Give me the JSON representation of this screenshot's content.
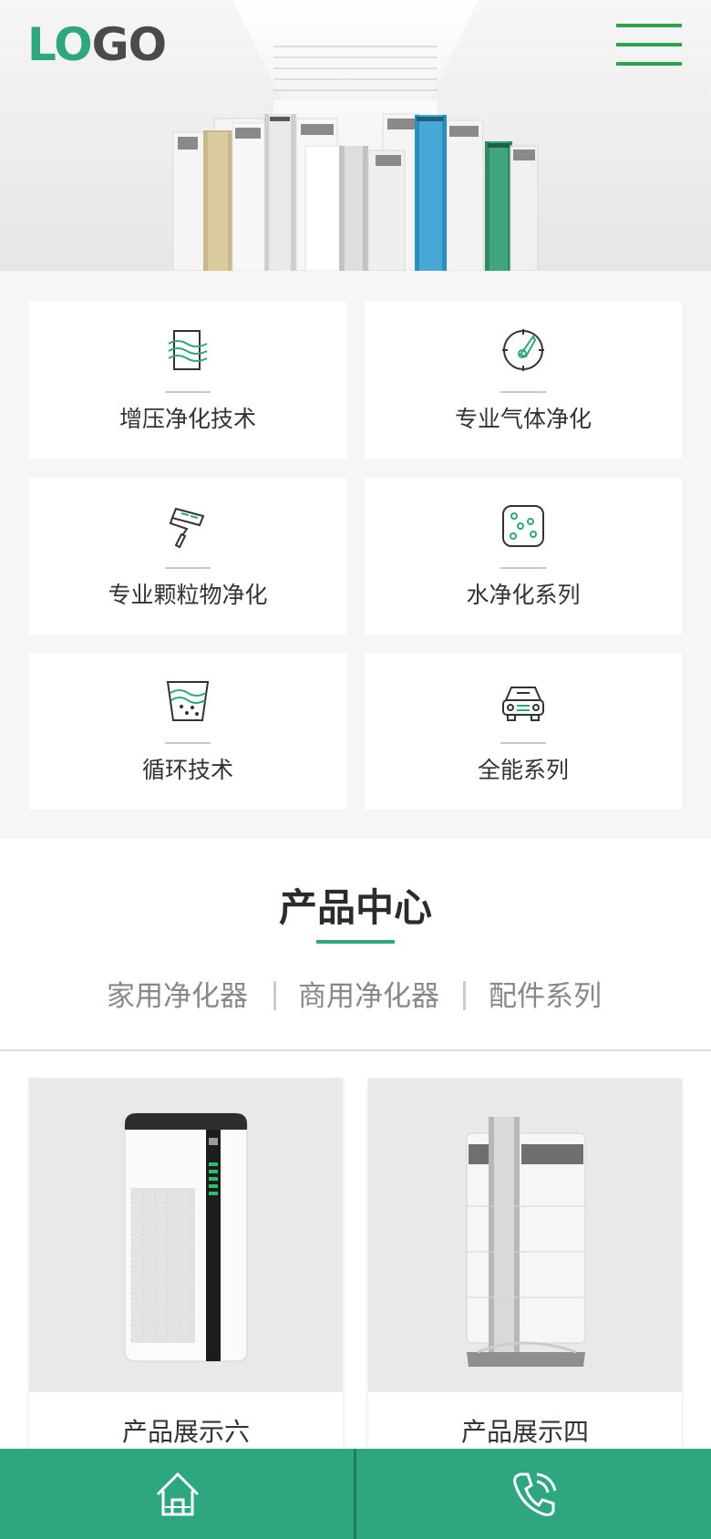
{
  "header": {
    "logo_text": "LOGO",
    "menu_icon": "hamburger-menu-icon"
  },
  "features": [
    {
      "label": "增压净化技术",
      "icon": "airflow-document-icon"
    },
    {
      "label": "专业气体净化",
      "icon": "gauge-target-icon"
    },
    {
      "label": "专业颗粒物净化",
      "icon": "paint-roller-icon"
    },
    {
      "label": "水净化系列",
      "icon": "dots-square-icon"
    },
    {
      "label": "循环技术",
      "icon": "water-bucket-icon"
    },
    {
      "label": "全能系列",
      "icon": "car-icon"
    }
  ],
  "product_center": {
    "title": "产品中心",
    "tabs": [
      "家用净化器",
      "商用净化器",
      "配件系列"
    ],
    "products": [
      {
        "name": "产品展示六"
      },
      {
        "name": "产品展示四"
      }
    ]
  },
  "bottom_bar": {
    "items": [
      {
        "icon": "home-icon"
      },
      {
        "icon": "phone-icon"
      }
    ]
  },
  "colors": {
    "accent": "#2ea67f",
    "menu_green": "#2aa64a",
    "text_dark": "#333333",
    "tab_gray": "#888888"
  }
}
